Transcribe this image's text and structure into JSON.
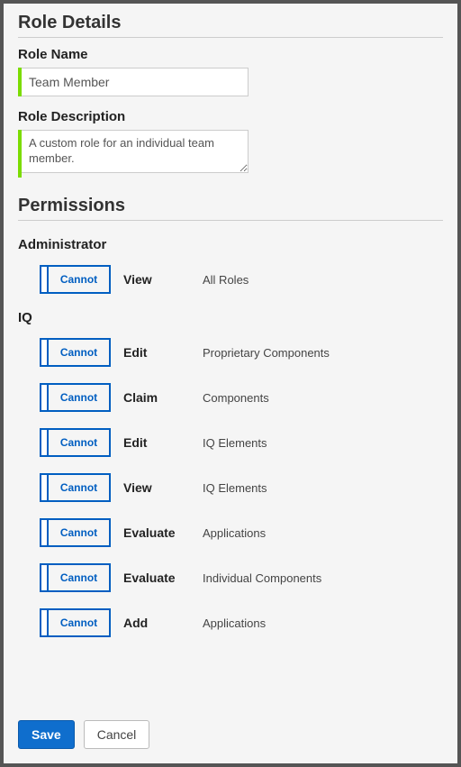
{
  "sections": {
    "details_title": "Role Details",
    "permissions_title": "Permissions"
  },
  "role": {
    "name_label": "Role Name",
    "name_value": "Team Member",
    "desc_label": "Role Description",
    "desc_value": "A custom role for an individual team member."
  },
  "toggle_label": "Cannot",
  "groups": [
    {
      "title": "Administrator",
      "perms": [
        {
          "action": "View",
          "target": "All Roles"
        }
      ]
    },
    {
      "title": "IQ",
      "perms": [
        {
          "action": "Edit",
          "target": "Proprietary Components"
        },
        {
          "action": "Claim",
          "target": "Components"
        },
        {
          "action": "Edit",
          "target": "IQ Elements"
        },
        {
          "action": "View",
          "target": "IQ Elements"
        },
        {
          "action": "Evaluate",
          "target": "Applications"
        },
        {
          "action": "Evaluate",
          "target": "Individual Components"
        },
        {
          "action": "Add",
          "target": "Applications"
        }
      ]
    }
  ],
  "footer": {
    "save": "Save",
    "cancel": "Cancel"
  }
}
